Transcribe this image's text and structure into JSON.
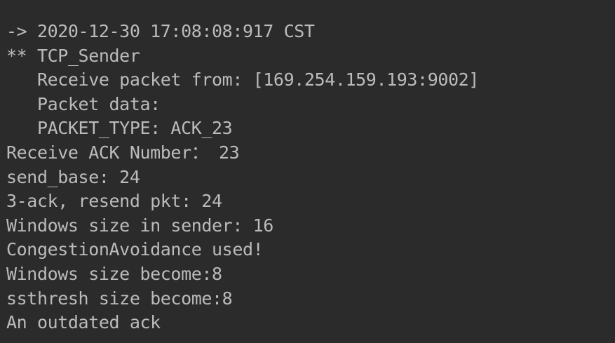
{
  "console": {
    "lines": [
      "-> 2020-12-30 17:08:08:917 CST",
      "** TCP_Sender",
      "   Receive packet from: [169.254.159.193:9002]",
      "   Packet data:",
      "   PACKET_TYPE: ACK_23",
      "Receive ACK Number： 23",
      "send_base: 24",
      "3-ack, resend pkt: 24",
      "Windows size in sender: 16",
      "CongestionAvoidance used!",
      "Windows size become:8",
      "ssthresh size become:8",
      "An outdated ack"
    ]
  },
  "colors": {
    "background": "#2b2b2b",
    "text": "#bbbbbb"
  }
}
